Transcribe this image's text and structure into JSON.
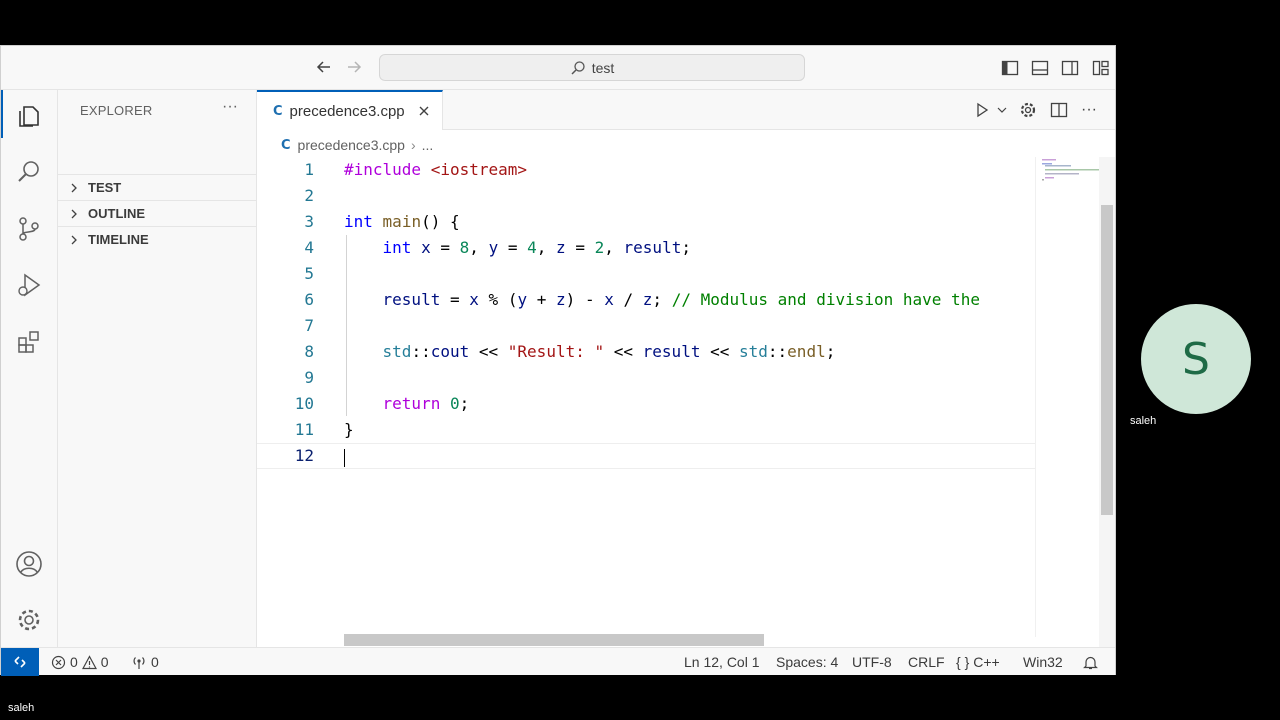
{
  "window": {
    "search_text": "test"
  },
  "sidebar": {
    "title": "EXPLORER",
    "sections": [
      {
        "label": "TEST"
      },
      {
        "label": "OUTLINE"
      },
      {
        "label": "TIMELINE"
      }
    ]
  },
  "editor": {
    "tab_label": "precedence3.cpp",
    "breadcrumb_file": "precedence3.cpp",
    "breadcrumb_more": "...",
    "line_numbers": [
      "1",
      "2",
      "3",
      "4",
      "5",
      "6",
      "7",
      "8",
      "9",
      "10",
      "11",
      "12"
    ],
    "current_line": 12
  },
  "statusbar": {
    "errors": "0",
    "warnings": "0",
    "ports": "0",
    "position": "Ln 12, Col 1",
    "spaces": "Spaces: 4",
    "encoding": "UTF-8",
    "eol": "CRLF",
    "language": "C++",
    "platform": "Win32"
  },
  "meeting": {
    "participant_initial": "S",
    "participant_name": "saleh",
    "self_name": "saleh"
  },
  "colors": {
    "accent": "#005fb8",
    "participant_bg": "#cfe7d8"
  }
}
